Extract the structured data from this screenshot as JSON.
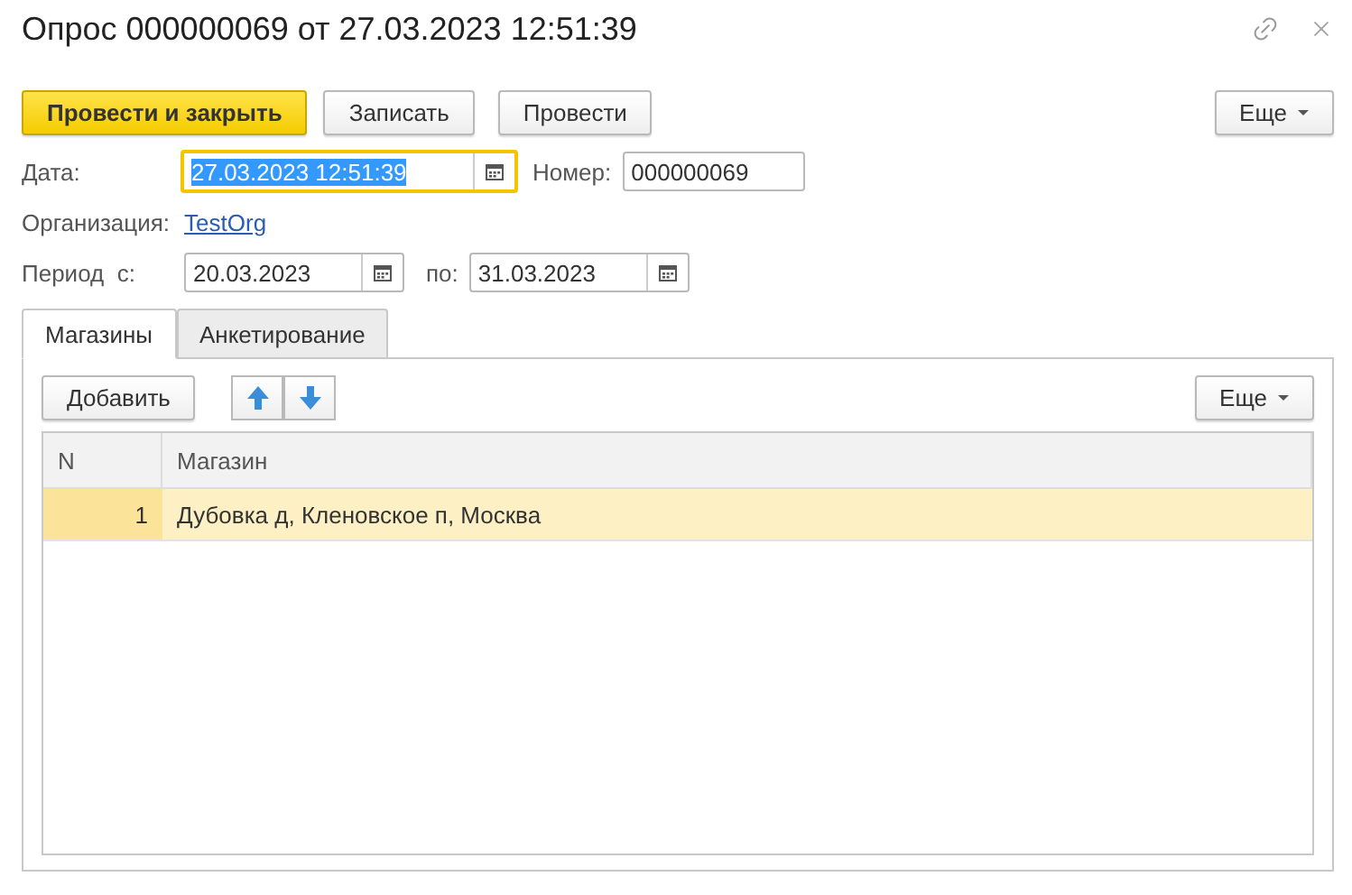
{
  "window": {
    "title": "Опрос 000000069 от 27.03.2023 12:51:39"
  },
  "toolbar": {
    "buttons": [
      {
        "label": "Провести и закрыть",
        "kind": "primary"
      },
      {
        "label": "Записать",
        "kind": "normal"
      },
      {
        "label": "Провести",
        "kind": "normal"
      }
    ],
    "more": "Еще"
  },
  "fields": {
    "date": {
      "label": "Дата:",
      "value": "27.03.2023 12:51:39",
      "focused": true,
      "text_selected": true
    },
    "number": {
      "label": "Номер:",
      "value": "000000069"
    },
    "organization": {
      "label": "Организация:",
      "value": "TestOrg"
    },
    "period": {
      "label": "Период  с:",
      "from": "20.03.2023",
      "to_label": "по:",
      "to": "31.03.2023"
    }
  },
  "tabs": [
    {
      "label": "Магазины",
      "selected": true
    },
    {
      "label": "Анкетирование",
      "selected": false
    }
  ],
  "table_toolbar": {
    "add": "Добавить",
    "more": "Еще"
  },
  "table": {
    "columns": [
      "N",
      "Магазин"
    ],
    "rows": [
      {
        "n": "1",
        "store": "Дубовка д, Кленовское п, Москва",
        "selected": true
      }
    ]
  }
}
